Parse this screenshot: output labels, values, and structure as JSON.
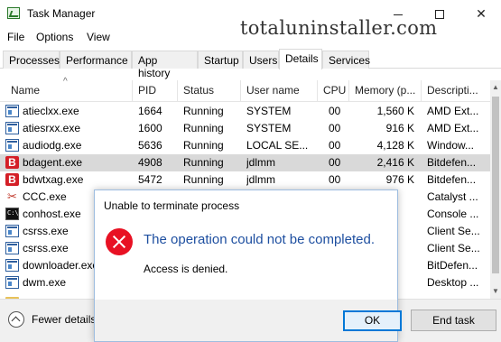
{
  "window": {
    "title": "Task Manager"
  },
  "watermark": "totaluninstaller.com",
  "menu": [
    "File",
    "Options",
    "View"
  ],
  "tabs": [
    "Processes",
    "Performance",
    "App history",
    "Startup",
    "Users",
    "Details",
    "Services"
  ],
  "active_tab": "Details",
  "columns": [
    "Name",
    "PID",
    "Status",
    "User name",
    "CPU",
    "Memory (p...",
    "Descripti..."
  ],
  "rows": [
    {
      "icon": "app-window-icon",
      "name": "atieclxx.exe",
      "pid": "1664",
      "status": "Running",
      "user": "SYSTEM",
      "cpu": "00",
      "mem": "1,560 K",
      "desc": "AMD Ext..."
    },
    {
      "icon": "app-window-icon",
      "name": "atiesrxx.exe",
      "pid": "1600",
      "status": "Running",
      "user": "SYSTEM",
      "cpu": "00",
      "mem": "916 K",
      "desc": "AMD Ext..."
    },
    {
      "icon": "app-window-icon",
      "name": "audiodg.exe",
      "pid": "5636",
      "status": "Running",
      "user": "LOCAL SE...",
      "cpu": "00",
      "mem": "4,128 K",
      "desc": "Window..."
    },
    {
      "icon": "bitdefender-icon",
      "name": "bdagent.exe",
      "pid": "4908",
      "status": "Running",
      "user": "jdlmm",
      "cpu": "00",
      "mem": "2,416 K",
      "desc": "Bitdefen...",
      "selected": true
    },
    {
      "icon": "bitdefender-icon",
      "name": "bdwtxag.exe",
      "pid": "5472",
      "status": "Running",
      "user": "jdlmm",
      "cpu": "00",
      "mem": "976 K",
      "desc": "Bitdefen..."
    },
    {
      "icon": "catalyst-icon",
      "name": "CCC.exe",
      "pid": "",
      "status": "",
      "user": "",
      "cpu": "",
      "mem": "",
      "desc": "Catalyst ..."
    },
    {
      "icon": "console-icon",
      "name": "conhost.exe",
      "pid": "",
      "status": "",
      "user": "",
      "cpu": "",
      "mem": "",
      "desc": "Console ..."
    },
    {
      "icon": "app-window-icon",
      "name": "csrss.exe",
      "pid": "",
      "status": "",
      "user": "",
      "cpu": "",
      "mem": "",
      "desc": "Client Se..."
    },
    {
      "icon": "app-window-icon",
      "name": "csrss.exe",
      "pid": "",
      "status": "",
      "user": "",
      "cpu": "",
      "mem": "",
      "desc": "Client Se..."
    },
    {
      "icon": "app-window-icon",
      "name": "downloader.exe",
      "pid": "",
      "status": "",
      "user": "",
      "cpu": "",
      "mem": "",
      "desc": "BitDefen..."
    },
    {
      "icon": "app-window-icon",
      "name": "dwm.exe",
      "pid": "",
      "status": "",
      "user": "",
      "cpu": "",
      "mem": "",
      "desc": "Desktop ..."
    },
    {
      "icon": "folder-icon",
      "name": "",
      "pid": "",
      "status": "",
      "user": "",
      "cpu": "",
      "mem": "",
      "desc": ""
    }
  ],
  "bottom": {
    "fewer_details": "Fewer details",
    "end_task": "End task"
  },
  "dialog": {
    "title": "Unable to terminate process",
    "main": "The operation could not be completed.",
    "sub": "Access is denied.",
    "ok": "OK"
  }
}
